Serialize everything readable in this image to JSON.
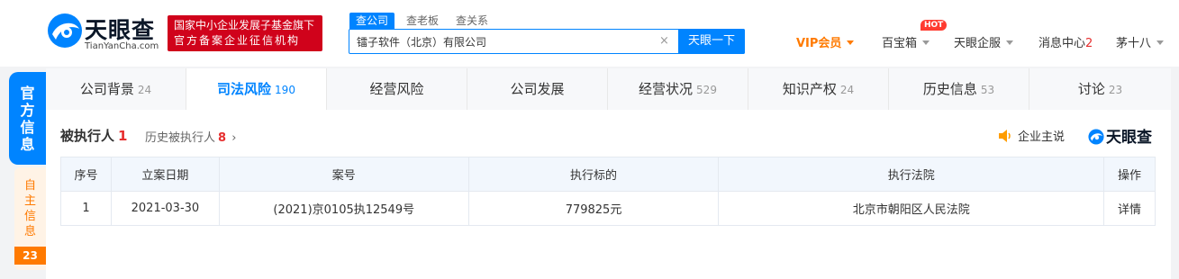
{
  "header": {
    "logo_title": "天眼查",
    "logo_sub": "TianYanCha.com",
    "slogan_line1": "国家中小企业发展子基金旗下",
    "slogan_line2": "官方备案企业征信机构",
    "search_tabs": [
      "查公司",
      "查老板",
      "查关系"
    ],
    "search_value": "镭子软件（北京）有限公司",
    "search_button": "天眼一下",
    "nav": {
      "vip": "VIP会员",
      "treasure": "百宝箱",
      "hot_badge": "HOT",
      "enterprise": "天眼企服",
      "messages": "消息中心",
      "messages_count": "2",
      "user": "茅十八"
    }
  },
  "side": {
    "official": "官方信息",
    "self": "自主信息",
    "self_count": "23"
  },
  "tabs": [
    {
      "label": "公司背景",
      "count": "24"
    },
    {
      "label": "司法风险",
      "count": "190"
    },
    {
      "label": "经营风险",
      "count": ""
    },
    {
      "label": "公司发展",
      "count": ""
    },
    {
      "label": "经营状况",
      "count": "529"
    },
    {
      "label": "知识产权",
      "count": "24"
    },
    {
      "label": "历史信息",
      "count": "53"
    },
    {
      "label": "讨论",
      "count": "23"
    }
  ],
  "section": {
    "title": "被执行人",
    "count": "1",
    "history_label": "历史被执行人",
    "history_count": "8",
    "company_say": "企业主说",
    "brand": "天眼查"
  },
  "table": {
    "headers": [
      "序号",
      "立案日期",
      "案号",
      "执行标的",
      "执行法院",
      "操作"
    ],
    "rows": [
      [
        "1",
        "2021-03-30",
        "(2021)京0105执12549号",
        "779825元",
        "北京市朝阳区人民法院",
        "详情"
      ]
    ]
  },
  "colors": {
    "accent": "#0084ff",
    "red": "#e62e2e",
    "orange": "#ff7a00"
  }
}
